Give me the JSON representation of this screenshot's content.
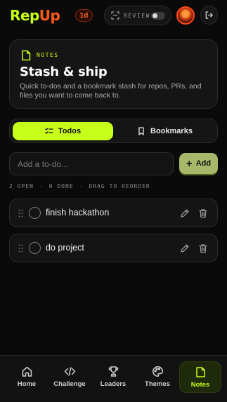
{
  "app": {
    "logo_part1": "Rep",
    "logo_part2": "Up",
    "streak_badge": "1d",
    "review_label": "REVIEW",
    "brand_colors": {
      "lime": "#c8ff1a",
      "orange": "#ff5a1a"
    }
  },
  "notes_card": {
    "eyebrow": "NOTES",
    "title": "Stash & ship",
    "description": "Quick to-dos and a bookmark stash for repos, PRs, and files you want to come back to.",
    "icon": "note-icon"
  },
  "tabs": [
    {
      "label": "Todos",
      "icon": "checklist-icon",
      "active": true
    },
    {
      "label": "Bookmarks",
      "icon": "bookmark-icon",
      "active": false
    }
  ],
  "todo_input": {
    "placeholder": "Add a to-do...",
    "value": ""
  },
  "add_button": {
    "label": "Add"
  },
  "stats": {
    "open": "2 OPEN",
    "done": "0 DONE",
    "hint": "DRAG TO REORDER",
    "separator": "·"
  },
  "todos": [
    {
      "text": "finish hackathon",
      "done": false
    },
    {
      "text": "do project",
      "done": false
    }
  ],
  "nav": [
    {
      "label": "Home",
      "icon": "home-icon",
      "active": false
    },
    {
      "label": "Challenge",
      "icon": "code-icon",
      "active": false
    },
    {
      "label": "Leaders",
      "icon": "trophy-icon",
      "active": false
    },
    {
      "label": "Themes",
      "icon": "palette-icon",
      "active": false
    },
    {
      "label": "Notes",
      "icon": "note-icon",
      "active": true
    }
  ]
}
